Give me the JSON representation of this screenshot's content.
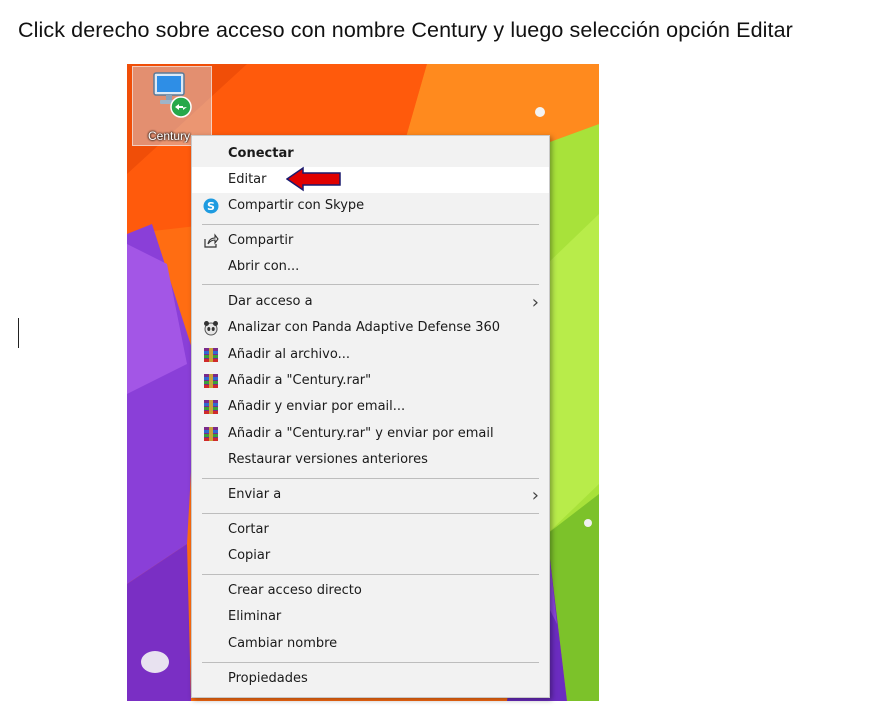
{
  "instruction": "Click derecho sobre acceso con nombre Century y luego selección opción Editar",
  "desktop": {
    "icon_label": "Century"
  },
  "context_menu": {
    "items": [
      {
        "label": "Conectar",
        "icon": "",
        "submenu": false,
        "bold": true
      },
      {
        "label": "Editar",
        "icon": "",
        "submenu": false,
        "highlighted": true
      },
      {
        "label": "Compartir con Skype",
        "icon": "skype-icon",
        "submenu": false
      },
      {
        "label": "Compartir",
        "icon": "share-icon",
        "submenu": false
      },
      {
        "label": "Abrir con...",
        "icon": "",
        "submenu": false
      },
      {
        "label": "Dar acceso a",
        "icon": "",
        "submenu": true
      },
      {
        "label": "Analizar con Panda Adaptive Defense 360",
        "icon": "panda-icon",
        "submenu": false
      },
      {
        "label": "Añadir al archivo...",
        "icon": "winrar-icon",
        "submenu": false
      },
      {
        "label": "Añadir a \"Century.rar\"",
        "icon": "winrar-icon",
        "submenu": false
      },
      {
        "label": "Añadir y enviar por email...",
        "icon": "winrar-icon",
        "submenu": false
      },
      {
        "label": "Añadir a \"Century.rar\" y enviar por email",
        "icon": "winrar-icon",
        "submenu": false
      },
      {
        "label": "Restaurar versiones anteriores",
        "icon": "",
        "submenu": false
      },
      {
        "label": "Enviar a",
        "icon": "",
        "submenu": true
      },
      {
        "label": "Cortar",
        "icon": "",
        "submenu": false
      },
      {
        "label": "Copiar",
        "icon": "",
        "submenu": false
      },
      {
        "label": "Crear acceso directo",
        "icon": "",
        "submenu": false
      },
      {
        "label": "Eliminar",
        "icon": "",
        "submenu": false
      },
      {
        "label": "Cambiar nombre",
        "icon": "",
        "submenu": false
      },
      {
        "label": "Propiedades",
        "icon": "",
        "submenu": false
      }
    ]
  },
  "annotation": {
    "arrow_color": "#e00000",
    "arrow_target": "Editar"
  }
}
